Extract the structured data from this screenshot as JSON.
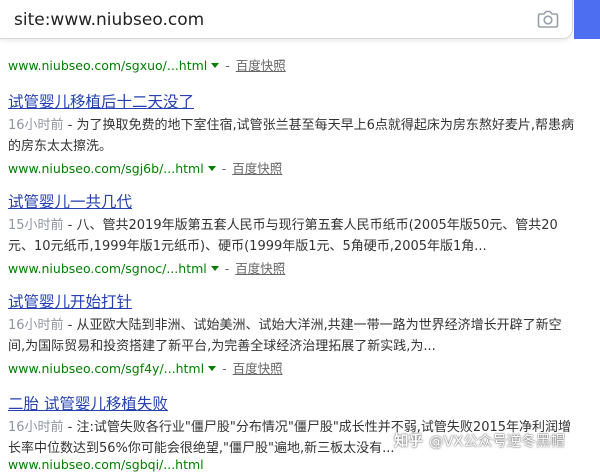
{
  "search": {
    "value": "site:www.niubseo.com",
    "camera_icon": "camera-icon",
    "button_color": "#4e6ef2"
  },
  "top_url": {
    "url": "www.niubseo.com/sgxuo/...html",
    "sep": "-",
    "kuaizhao": "百度快照"
  },
  "results": [
    {
      "title": "试管婴儿移植后十二天没了",
      "time": "16小时前",
      "snippet": " - 为了换取免费的地下室住宿,试管张兰甚至每天早上6点就得起床为房东熬好麦片,帮患病的房东太太擦洗。",
      "url": "www.niubseo.com/sgj6b/...html",
      "sep": "-",
      "kuaizhao": "百度快照"
    },
    {
      "title": "试管婴儿一共几代",
      "time": "15小时前",
      "snippet": " - 八、管共2019年版第五套人民币与现行第五套人民币纸币(2005年版50元、管共20元、10元纸币,1999年版1元纸币)、硬币(1999年版1元、5角硬币,2005年版1角...",
      "url": "www.niubseo.com/sgnoc/...html",
      "sep": "-",
      "kuaizhao": "百度快照"
    },
    {
      "title": "试管婴儿开始打针",
      "time": "16小时前",
      "snippet": " - 从亚欧大陆到非洲、试始美洲、试始大洋洲,共建一带一路为世界经济增长开辟了新空间,为国际贸易和投资搭建了新平台,为完善全球经济治理拓展了新实践,为...",
      "url": "www.niubseo.com/sgf4y/...html",
      "sep": "-",
      "kuaizhao": "百度快照"
    },
    {
      "title": "二胎 试管婴儿移植失败",
      "time": "16小时前",
      "snippet": " - 注:试管失败各行业\"僵尸股\"分布情况\"僵尸股\"成长性并不弱,试管失败2015年净利润增长率中位数达到56%你可能会很绝望,\"僵尸股\"遍地,新三板太没有...",
      "url": "www.niubseo.com/sgbqi/...html"
    }
  ],
  "watermark": {
    "logo": "知乎",
    "text": "@VX公众号逆冬黑帽"
  }
}
